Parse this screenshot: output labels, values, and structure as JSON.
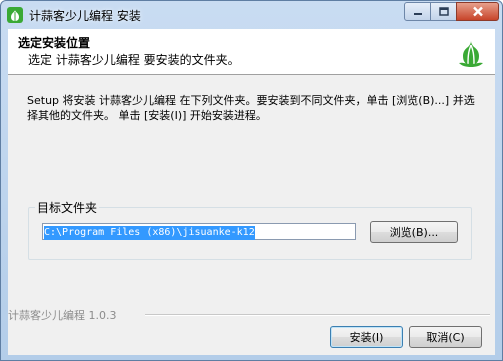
{
  "window": {
    "title": "计蒜客少儿编程 安装"
  },
  "header": {
    "title": "选定安装位置",
    "subtitle": "选定 计蒜客少儿编程 要安装的文件夹。"
  },
  "intro": {
    "text": "Setup 将安装 计蒜客少儿编程 在下列文件夹。要安装到不同文件夹，单击 [浏览(B)...] 并选择其他的文件夹。 单击 [安装(I)] 开始安装进程。"
  },
  "destination": {
    "group_label": "目标文件夹",
    "path": "C:\\Program Files (x86)\\jisuanke-k12",
    "browse_label": "浏览(B)..."
  },
  "footer": {
    "brand": "计蒜客少儿编程 1.0.3",
    "install_label": "安装(I)",
    "cancel_label": "取消(C)"
  },
  "icons": {
    "app": "garlic-icon",
    "logo": "garlic-logo-icon"
  },
  "colors": {
    "accent_green": "#3aa935",
    "selection": "#3399ff",
    "close_red": "#c7442a"
  }
}
